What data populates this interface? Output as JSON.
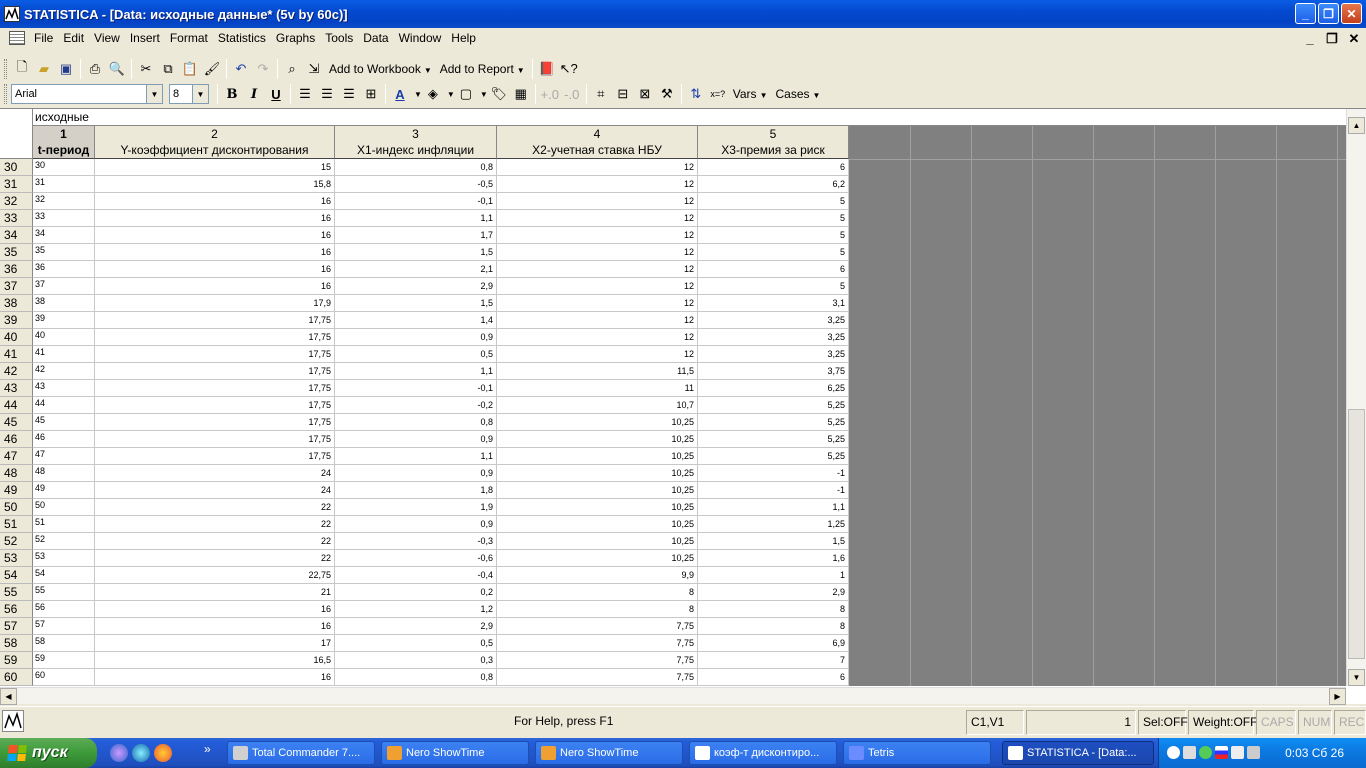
{
  "window": {
    "title": "STATISTICA - [Data: исходные данные* (5v by 60c)]"
  },
  "menu": [
    "File",
    "Edit",
    "View",
    "Insert",
    "Format",
    "Statistics",
    "Graphs",
    "Tools",
    "Data",
    "Window",
    "Help"
  ],
  "toolbar": {
    "add_to_workbook": "Add to Workbook",
    "add_to_report": "Add to Report",
    "font_name": "Arial",
    "font_size": "8",
    "vars": "Vars",
    "cases": "Cases",
    "bold": "B",
    "italic": "I",
    "underline": "U"
  },
  "sheet": {
    "name": "исходные",
    "columns": [
      {
        "num": "1",
        "name": "t-период"
      },
      {
        "num": "2",
        "name": "Y-коэффициент дисконтирования"
      },
      {
        "num": "3",
        "name": "X1-индекс инфляции"
      },
      {
        "num": "4",
        "name": "X2-учетная ставка НБУ"
      },
      {
        "num": "5",
        "name": "X3-премия за риск"
      }
    ],
    "rows": [
      [
        "30",
        "30",
        "15",
        "0,8",
        "12",
        "6"
      ],
      [
        "31",
        "31",
        "15,8",
        "-0,5",
        "12",
        "6,2"
      ],
      [
        "32",
        "32",
        "16",
        "-0,1",
        "12",
        "5"
      ],
      [
        "33",
        "33",
        "16",
        "1,1",
        "12",
        "5"
      ],
      [
        "34",
        "34",
        "16",
        "1,7",
        "12",
        "5"
      ],
      [
        "35",
        "35",
        "16",
        "1,5",
        "12",
        "5"
      ],
      [
        "36",
        "36",
        "16",
        "2,1",
        "12",
        "6"
      ],
      [
        "37",
        "37",
        "16",
        "2,9",
        "12",
        "5"
      ],
      [
        "38",
        "38",
        "17,9",
        "1,5",
        "12",
        "3,1"
      ],
      [
        "39",
        "39",
        "17,75",
        "1,4",
        "12",
        "3,25"
      ],
      [
        "40",
        "40",
        "17,75",
        "0,9",
        "12",
        "3,25"
      ],
      [
        "41",
        "41",
        "17,75",
        "0,5",
        "12",
        "3,25"
      ],
      [
        "42",
        "42",
        "17,75",
        "1,1",
        "11,5",
        "3,75"
      ],
      [
        "43",
        "43",
        "17,75",
        "-0,1",
        "11",
        "6,25"
      ],
      [
        "44",
        "44",
        "17,75",
        "-0,2",
        "10,7",
        "5,25"
      ],
      [
        "45",
        "45",
        "17,75",
        "0,8",
        "10,25",
        "5,25"
      ],
      [
        "46",
        "46",
        "17,75",
        "0,9",
        "10,25",
        "5,25"
      ],
      [
        "47",
        "47",
        "17,75",
        "1,1",
        "10,25",
        "5,25"
      ],
      [
        "48",
        "48",
        "24",
        "0,9",
        "10,25",
        "-1"
      ],
      [
        "49",
        "49",
        "24",
        "1,8",
        "10,25",
        "-1"
      ],
      [
        "50",
        "50",
        "22",
        "1,9",
        "10,25",
        "1,1"
      ],
      [
        "51",
        "51",
        "22",
        "0,9",
        "10,25",
        "1,25"
      ],
      [
        "52",
        "52",
        "22",
        "-0,3",
        "10,25",
        "1,5"
      ],
      [
        "53",
        "53",
        "22",
        "-0,6",
        "10,25",
        "1,6"
      ],
      [
        "54",
        "54",
        "22,75",
        "-0,4",
        "9,9",
        "1"
      ],
      [
        "55",
        "55",
        "21",
        "0,2",
        "8",
        "2,9"
      ],
      [
        "56",
        "56",
        "16",
        "1,2",
        "8",
        "8"
      ],
      [
        "57",
        "57",
        "16",
        "2,9",
        "7,75",
        "8"
      ],
      [
        "58",
        "58",
        "17",
        "0,5",
        "7,75",
        "6,9"
      ],
      [
        "59",
        "59",
        "16,5",
        "0,3",
        "7,75",
        "7"
      ],
      [
        "60",
        "60",
        "16",
        "0,8",
        "7,75",
        "6"
      ]
    ]
  },
  "status": {
    "help": "For Help, press F1",
    "cell": "C1,V1",
    "value": "1",
    "sel": "Sel:OFF",
    "weight": "Weight:OFF",
    "caps": "CAPS",
    "num": "NUM",
    "rec": "REC"
  },
  "taskbar": {
    "start": "пуск",
    "more": "»",
    "tasks": [
      {
        "label": "Total Commander 7....",
        "icon_color": "#d0d0d0"
      },
      {
        "label": "Nero ShowTime",
        "icon_color": "#f0a030"
      },
      {
        "label": "Nero ShowTime",
        "icon_color": "#f0a030"
      },
      {
        "label": "коэф-т дисконтиро...",
        "icon_color": "#ffffff"
      },
      {
        "label": "Tetris",
        "icon_color": "#6a8cff"
      },
      {
        "label": "STATISTICA - [Data:...",
        "icon_color": "#ffffff"
      }
    ],
    "clock": "0:03 Сб 26"
  }
}
